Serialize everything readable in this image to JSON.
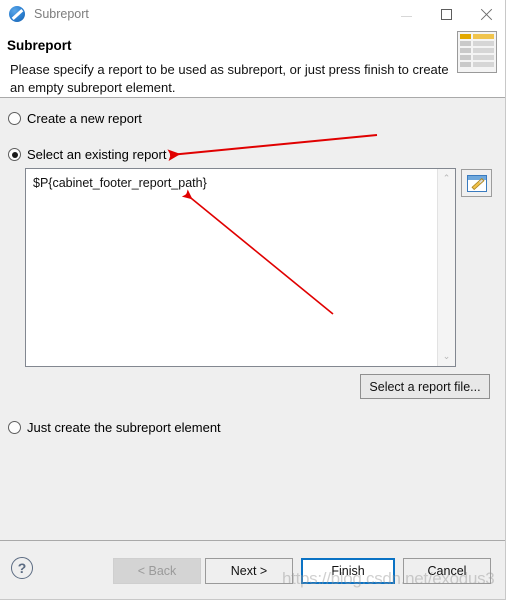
{
  "window": {
    "title": "Subreport",
    "icon": "jaspersoft-subreport-icon",
    "minimize_label": "",
    "maximize_label": "",
    "close_label": ""
  },
  "header": {
    "title": "Subreport",
    "description": "Please specify a report to be used as subreport, or just press finish to create an empty subreport element.",
    "icon": "report-document-icon"
  },
  "options": {
    "create_new": {
      "label": "Create a new report",
      "checked": false
    },
    "select_existing": {
      "label": "Select an existing report",
      "checked": true
    },
    "just_create": {
      "label": "Just create the subreport element",
      "checked": false
    }
  },
  "report_path": {
    "value": "$P{cabinet_footer_report_path}",
    "scroll_up_glyph": "⌃",
    "scroll_down_glyph": "⌄"
  },
  "buttons": {
    "edit_expression": "edit-expression-icon",
    "select_report_file": "Select a report file...",
    "back": "< Back",
    "next": "Next >",
    "finish": "Finish",
    "cancel": "Cancel",
    "help": "?"
  },
  "watermark": {
    "text": "https://blog.csdn.net/exodus3"
  },
  "annotations": {
    "arrow_color": "#e00000",
    "arrow1_label": "arrow-pointing-to-select-an-existing-report",
    "arrow2_label": "arrow-pointing-to-report-path-expression"
  }
}
